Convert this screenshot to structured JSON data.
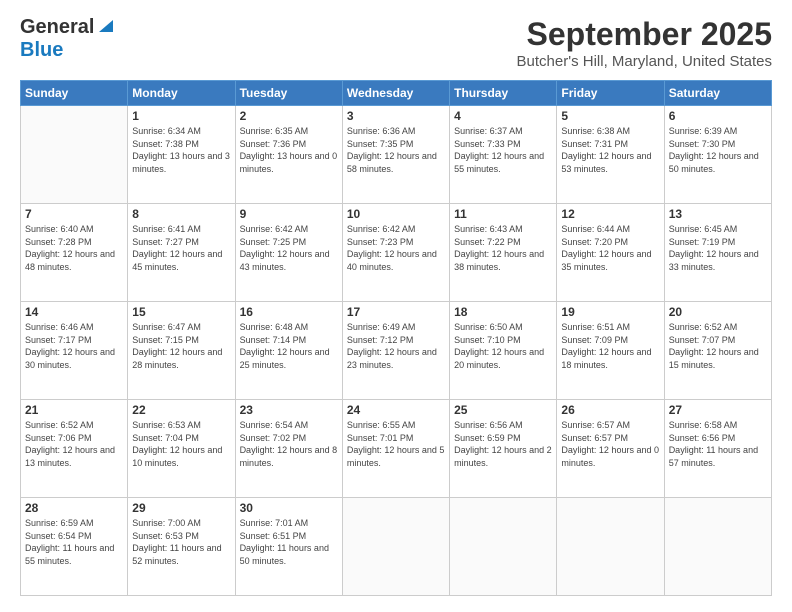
{
  "logo": {
    "line1": "General",
    "line2": "Blue"
  },
  "header": {
    "month": "September 2025",
    "location": "Butcher's Hill, Maryland, United States"
  },
  "weekdays": [
    "Sunday",
    "Monday",
    "Tuesday",
    "Wednesday",
    "Thursday",
    "Friday",
    "Saturday"
  ],
  "weeks": [
    [
      {
        "day": "",
        "sunrise": "",
        "sunset": "",
        "daylight": ""
      },
      {
        "day": "1",
        "sunrise": "Sunrise: 6:34 AM",
        "sunset": "Sunset: 7:38 PM",
        "daylight": "Daylight: 13 hours and 3 minutes."
      },
      {
        "day": "2",
        "sunrise": "Sunrise: 6:35 AM",
        "sunset": "Sunset: 7:36 PM",
        "daylight": "Daylight: 13 hours and 0 minutes."
      },
      {
        "day": "3",
        "sunrise": "Sunrise: 6:36 AM",
        "sunset": "Sunset: 7:35 PM",
        "daylight": "Daylight: 12 hours and 58 minutes."
      },
      {
        "day": "4",
        "sunrise": "Sunrise: 6:37 AM",
        "sunset": "Sunset: 7:33 PM",
        "daylight": "Daylight: 12 hours and 55 minutes."
      },
      {
        "day": "5",
        "sunrise": "Sunrise: 6:38 AM",
        "sunset": "Sunset: 7:31 PM",
        "daylight": "Daylight: 12 hours and 53 minutes."
      },
      {
        "day": "6",
        "sunrise": "Sunrise: 6:39 AM",
        "sunset": "Sunset: 7:30 PM",
        "daylight": "Daylight: 12 hours and 50 minutes."
      }
    ],
    [
      {
        "day": "7",
        "sunrise": "Sunrise: 6:40 AM",
        "sunset": "Sunset: 7:28 PM",
        "daylight": "Daylight: 12 hours and 48 minutes."
      },
      {
        "day": "8",
        "sunrise": "Sunrise: 6:41 AM",
        "sunset": "Sunset: 7:27 PM",
        "daylight": "Daylight: 12 hours and 45 minutes."
      },
      {
        "day": "9",
        "sunrise": "Sunrise: 6:42 AM",
        "sunset": "Sunset: 7:25 PM",
        "daylight": "Daylight: 12 hours and 43 minutes."
      },
      {
        "day": "10",
        "sunrise": "Sunrise: 6:42 AM",
        "sunset": "Sunset: 7:23 PM",
        "daylight": "Daylight: 12 hours and 40 minutes."
      },
      {
        "day": "11",
        "sunrise": "Sunrise: 6:43 AM",
        "sunset": "Sunset: 7:22 PM",
        "daylight": "Daylight: 12 hours and 38 minutes."
      },
      {
        "day": "12",
        "sunrise": "Sunrise: 6:44 AM",
        "sunset": "Sunset: 7:20 PM",
        "daylight": "Daylight: 12 hours and 35 minutes."
      },
      {
        "day": "13",
        "sunrise": "Sunrise: 6:45 AM",
        "sunset": "Sunset: 7:19 PM",
        "daylight": "Daylight: 12 hours and 33 minutes."
      }
    ],
    [
      {
        "day": "14",
        "sunrise": "Sunrise: 6:46 AM",
        "sunset": "Sunset: 7:17 PM",
        "daylight": "Daylight: 12 hours and 30 minutes."
      },
      {
        "day": "15",
        "sunrise": "Sunrise: 6:47 AM",
        "sunset": "Sunset: 7:15 PM",
        "daylight": "Daylight: 12 hours and 28 minutes."
      },
      {
        "day": "16",
        "sunrise": "Sunrise: 6:48 AM",
        "sunset": "Sunset: 7:14 PM",
        "daylight": "Daylight: 12 hours and 25 minutes."
      },
      {
        "day": "17",
        "sunrise": "Sunrise: 6:49 AM",
        "sunset": "Sunset: 7:12 PM",
        "daylight": "Daylight: 12 hours and 23 minutes."
      },
      {
        "day": "18",
        "sunrise": "Sunrise: 6:50 AM",
        "sunset": "Sunset: 7:10 PM",
        "daylight": "Daylight: 12 hours and 20 minutes."
      },
      {
        "day": "19",
        "sunrise": "Sunrise: 6:51 AM",
        "sunset": "Sunset: 7:09 PM",
        "daylight": "Daylight: 12 hours and 18 minutes."
      },
      {
        "day": "20",
        "sunrise": "Sunrise: 6:52 AM",
        "sunset": "Sunset: 7:07 PM",
        "daylight": "Daylight: 12 hours and 15 minutes."
      }
    ],
    [
      {
        "day": "21",
        "sunrise": "Sunrise: 6:52 AM",
        "sunset": "Sunset: 7:06 PM",
        "daylight": "Daylight: 12 hours and 13 minutes."
      },
      {
        "day": "22",
        "sunrise": "Sunrise: 6:53 AM",
        "sunset": "Sunset: 7:04 PM",
        "daylight": "Daylight: 12 hours and 10 minutes."
      },
      {
        "day": "23",
        "sunrise": "Sunrise: 6:54 AM",
        "sunset": "Sunset: 7:02 PM",
        "daylight": "Daylight: 12 hours and 8 minutes."
      },
      {
        "day": "24",
        "sunrise": "Sunrise: 6:55 AM",
        "sunset": "Sunset: 7:01 PM",
        "daylight": "Daylight: 12 hours and 5 minutes."
      },
      {
        "day": "25",
        "sunrise": "Sunrise: 6:56 AM",
        "sunset": "Sunset: 6:59 PM",
        "daylight": "Daylight: 12 hours and 2 minutes."
      },
      {
        "day": "26",
        "sunrise": "Sunrise: 6:57 AM",
        "sunset": "Sunset: 6:57 PM",
        "daylight": "Daylight: 12 hours and 0 minutes."
      },
      {
        "day": "27",
        "sunrise": "Sunrise: 6:58 AM",
        "sunset": "Sunset: 6:56 PM",
        "daylight": "Daylight: 11 hours and 57 minutes."
      }
    ],
    [
      {
        "day": "28",
        "sunrise": "Sunrise: 6:59 AM",
        "sunset": "Sunset: 6:54 PM",
        "daylight": "Daylight: 11 hours and 55 minutes."
      },
      {
        "day": "29",
        "sunrise": "Sunrise: 7:00 AM",
        "sunset": "Sunset: 6:53 PM",
        "daylight": "Daylight: 11 hours and 52 minutes."
      },
      {
        "day": "30",
        "sunrise": "Sunrise: 7:01 AM",
        "sunset": "Sunset: 6:51 PM",
        "daylight": "Daylight: 11 hours and 50 minutes."
      },
      {
        "day": "",
        "sunrise": "",
        "sunset": "",
        "daylight": ""
      },
      {
        "day": "",
        "sunrise": "",
        "sunset": "",
        "daylight": ""
      },
      {
        "day": "",
        "sunrise": "",
        "sunset": "",
        "daylight": ""
      },
      {
        "day": "",
        "sunrise": "",
        "sunset": "",
        "daylight": ""
      }
    ]
  ]
}
